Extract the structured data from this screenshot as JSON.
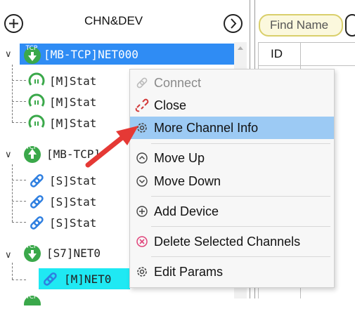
{
  "header": {
    "title": "CHN&DEV",
    "find_label": "Find Name"
  },
  "grid": {
    "id_header": "ID"
  },
  "tree": {
    "nodes": [
      {
        "label": "[MB-TCP]NET000",
        "badge": "TCP"
      },
      {
        "label": "[M]Stat"
      },
      {
        "label": "[M]Stat"
      },
      {
        "label": "[M]Stat"
      },
      {
        "label": "[MB-TCP]",
        "badge": "TCP"
      },
      {
        "label": "[S]Stat"
      },
      {
        "label": "[S]Stat"
      },
      {
        "label": "[S]Stat"
      },
      {
        "label": "[S7]NET0",
        "badge": "TCP"
      },
      {
        "label": "[M]NET0"
      },
      {
        "badge": "TCP"
      }
    ]
  },
  "context_menu": {
    "items": [
      {
        "label": "Connect",
        "icon": "link-icon",
        "disabled": true
      },
      {
        "label": "Close",
        "icon": "broken-link-icon"
      },
      {
        "label": "More Channel Info",
        "icon": "gear-icon",
        "highlighted": true
      },
      {
        "label": "Move Up",
        "icon": "arrow-up-circle-icon"
      },
      {
        "label": "Move Down",
        "icon": "arrow-down-circle-icon"
      },
      {
        "label": "Add Device",
        "icon": "plus-circle-icon"
      },
      {
        "label": "Delete Selected Channels",
        "icon": "x-circle-icon"
      },
      {
        "label": "Edit Params",
        "icon": "gear-icon"
      }
    ]
  },
  "colors": {
    "selection": "#2f8cf4",
    "highlight": "#9ccaf4",
    "cyan_row": "#1fe9f3",
    "tcp_badge": "#3aa84a",
    "arrow": "#e53935"
  }
}
